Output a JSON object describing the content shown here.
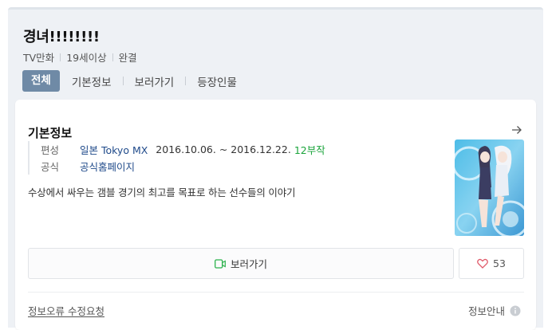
{
  "header": {
    "title": "경녀!!!!!!!!",
    "meta": [
      "TV만화",
      "19세이상",
      "완결"
    ]
  },
  "tabs": [
    {
      "label": "전체",
      "active": true
    },
    {
      "label": "기본정보",
      "active": false
    },
    {
      "label": "보러가기",
      "active": false
    },
    {
      "label": "등장인물",
      "active": false
    }
  ],
  "card": {
    "title": "기본정보",
    "broadcast": {
      "label": "편성",
      "channel": "일본 Tokyo MX",
      "dates": "2016.10.06. ~ 2016.12.22.",
      "episodes": "12부작"
    },
    "official": {
      "label": "공식",
      "link": "공식홈페이지"
    },
    "description": "수상에서 싸우는 갬블 경기의 최고를 목표로 하는 선수들의 이야기",
    "watch_label": "보러가기",
    "like_count": "53",
    "report_link": "정보오류 수정요청",
    "info_guide": "정보안내"
  },
  "colors": {
    "tab_active": "#6f8aa6",
    "link": "#1f4a8a",
    "episodes": "#1aa43b",
    "heart": "#e05a6a",
    "play": "#2bb24c"
  },
  "icons": [
    "arrow-right-icon",
    "play-icon",
    "heart-icon",
    "info-icon"
  ]
}
